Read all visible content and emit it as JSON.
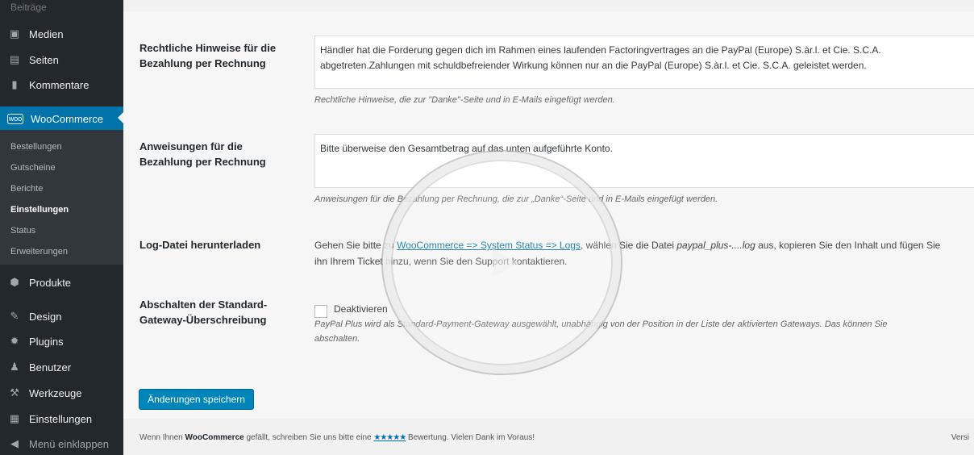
{
  "sidebar": {
    "top_partial": "Beiträge",
    "items": [
      {
        "label": "Medien",
        "icon": "media-icon"
      },
      {
        "label": "Seiten",
        "icon": "pages-icon"
      },
      {
        "label": "Kommentare",
        "icon": "comments-icon"
      },
      {
        "label": "WooCommerce",
        "icon": "woocommerce-icon"
      },
      {
        "label": "Produkte",
        "icon": "products-icon"
      },
      {
        "label": "Design",
        "icon": "design-icon"
      },
      {
        "label": "Plugins",
        "icon": "plugins-icon"
      },
      {
        "label": "Benutzer",
        "icon": "users-icon"
      },
      {
        "label": "Werkzeuge",
        "icon": "tools-icon"
      },
      {
        "label": "Einstellungen",
        "icon": "settings-icon"
      },
      {
        "label": "Menü einklappen",
        "icon": "collapse-icon"
      }
    ],
    "submenu": [
      "Bestellungen",
      "Gutscheine",
      "Berichte",
      "Einstellungen",
      "Status",
      "Erweiterungen"
    ],
    "submenu_current": "Einstellungen"
  },
  "settings": {
    "legal": {
      "label_line1": "Rechtliche Hinweise für die",
      "label_line2": "Bezahlung per Rechnung",
      "value_line1": "Händler hat die Forderung gegen dich im Rahmen eines laufenden Factoringvertrages an die PayPal (Europe) S.àr.l. et Cie. S.C.A.",
      "value_line2": "abgetreten.Zahlungen mit schuldbefreiender Wirkung können nur an die PayPal (Europe) S.àr.l. et Cie. S.C.A. geleistet werden.",
      "description": "Rechtliche Hinweise, die zur \"Danke\"-Seite und in E-Mails eingefügt werden."
    },
    "instructions": {
      "label_line1": "Anweisungen für die",
      "label_line2": "Bezahlung per Rechnung",
      "value": "Bitte überweise den Gesamtbetrag auf das unten aufgeführte Konto.",
      "description": "Anweisungen für die Bezahlung per Rechnung, die zur „Danke“-Seite und in E-Mails eingefügt werden."
    },
    "log": {
      "label": "Log-Datei herunterladen",
      "text_before": "Gehen Sie bitte zu ",
      "link": "WooCommerce => System Status => Logs",
      "text_after": ", wählen Sie die Datei ",
      "file": "paypal_plus-....log",
      "text_end": " aus, kopieren Sie den Inhalt und fügen Sie",
      "line2": "ihn Ihrem Ticket hinzu, wenn Sie den Support kontaktieren."
    },
    "override": {
      "label_line1": "Abschalten der Standard-",
      "label_line2": "Gateway-Überschreibung",
      "checkbox_label": "Deaktivieren",
      "description_line1": "PayPal Plus wird als Standard-Payment-Gateway ausgewählt, unabhängig von der Position in der Liste der aktivierten Gateways. Das können Sie",
      "description_line2": "abschalten."
    },
    "save_label": "Änderungen speichern"
  },
  "footer": {
    "before": "Wenn Ihnen ",
    "brand": "WooCommerce",
    "middle": " gefällt, schreiben Sie uns bitte eine ",
    "stars": "★★★★★",
    "after": " Bewertung. Vielen Dank im Voraus!",
    "version": "Versi"
  }
}
